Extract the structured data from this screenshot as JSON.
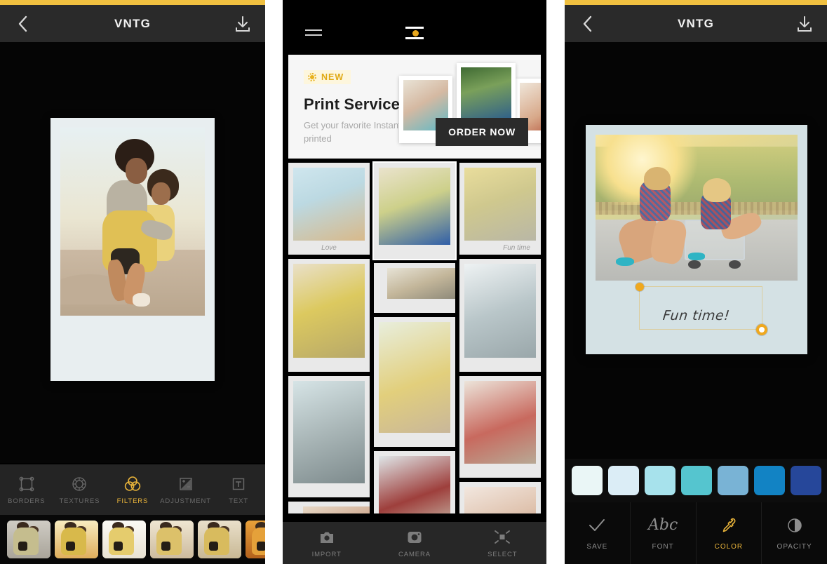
{
  "panel1": {
    "navbar": {
      "back_icon": "chevron-left-icon",
      "title": "VNTG",
      "download_icon": "download-icon"
    },
    "tools": [
      {
        "label": "BORDERS",
        "icon": "borders-icon",
        "active": false
      },
      {
        "label": "TEXTURES",
        "icon": "textures-icon",
        "active": false
      },
      {
        "label": "FILTERS",
        "icon": "filters-icon",
        "active": true
      },
      {
        "label": "ADJUSTMENT",
        "icon": "adjustment-icon",
        "active": false
      },
      {
        "label": "TEXT",
        "icon": "text-icon",
        "active": false
      }
    ],
    "active_tool": "FILTERS",
    "accent_color": "#e8b33a",
    "filter_thumbnails": [
      {
        "name": "filter-thumb-1",
        "tint": "#b9b4ab"
      },
      {
        "name": "filter-thumb-2",
        "tint": "#e8cf8e"
      },
      {
        "name": "filter-thumb-3",
        "tint": "#f3f0e6"
      },
      {
        "name": "filter-thumb-4",
        "tint": "#ddd0b5"
      },
      {
        "name": "filter-thumb-5",
        "tint": "#d6c7a9"
      },
      {
        "name": "filter-thumb-6",
        "tint": "#c98a2e"
      }
    ]
  },
  "panel2": {
    "header": {
      "menu_icon": "hamburger-menu-icon",
      "logo_icon": "app-logo-icon"
    },
    "banner": {
      "badge": "NEW",
      "badge_icon": "sun-icon",
      "title": "Print Service",
      "subtitle": "Get your favorite Instants printed",
      "cta": "ORDER NOW"
    },
    "grid": {
      "columns": [
        {
          "cards": [
            {
              "name": "photo-card-guitar-couple",
              "caption": "Love",
              "h": 122,
              "tint": "linear-gradient(160deg,#cfe6ee 0%,#bcd9e2 40%,#d8b98a 100%)",
              "selected": false
            },
            {
              "name": "photo-card-hat-woman",
              "caption": "",
              "h": 148,
              "tint": "linear-gradient(160deg,#e9e0c9 0%,#dcc95f 45%,#b7a86a 100%)",
              "selected": false
            },
            {
              "name": "photo-card-bw-piggyback",
              "caption": "",
              "h": 160,
              "tint": "linear-gradient(160deg,#d6e4e6 0%,#a9b6b7 50%,#7d8a8c 100%)",
              "selected": false
            },
            {
              "name": "photo-card-three-girls",
              "caption": "",
              "h": 62,
              "tint": "linear-gradient(160deg,#e7d8c6 0%,#cfa98f 60%,#b59577 100%)",
              "selected": false
            }
          ]
        },
        {
          "cards": [
            {
              "name": "photo-card-mother-child",
              "caption": "",
              "h": 128,
              "tint": "linear-gradient(160deg,#eae3cd 0%,#cdd08a 45%,#2f5ea8 100%)",
              "selected": true
            },
            {
              "name": "photo-card-kids-walking",
              "caption": "",
              "h": 58,
              "tint": "linear-gradient(160deg,#e7e3d6 0%,#c3b69a 50%,#8c8878 100%)",
              "selected": false
            },
            {
              "name": "photo-card-beach-piggyback",
              "caption": "",
              "h": 172,
              "tint": "linear-gradient(160deg,#e8eedd 0%,#e2cf7c 55%,#c9b79a 100%)",
              "selected": false
            },
            {
              "name": "photo-card-red-cardigan",
              "caption": "",
              "h": 120,
              "tint": "linear-gradient(160deg,#dfe6e8 0%,#9e3f3c 55%,#c8bfae 100%)",
              "selected": false
            }
          ]
        },
        {
          "cards": [
            {
              "name": "photo-card-skateboard-girls",
              "caption": "Fun time",
              "h": 122,
              "tint": "linear-gradient(160deg,#e9dd9c 0%,#cfc88e 45%,#b9b7a6 100%)",
              "selected": false
            },
            {
              "name": "photo-card-bw-blossom",
              "caption": "",
              "h": 148,
              "tint": "linear-gradient(160deg,#eef2f3 0%,#b9c6c9 50%,#9aa7aa 100%)",
              "selected": false
            },
            {
              "name": "photo-card-guitar-girl",
              "caption": "",
              "h": 132,
              "tint": "linear-gradient(160deg,#ece4da 0%,#c8695e 55%,#b8a995 100%)",
              "selected": false
            },
            {
              "name": "photo-card-child-portrait",
              "caption": "",
              "h": 92,
              "tint": "linear-gradient(160deg,#f2e7df 0%,#e0c4b0 55%,#c79f87 100%)",
              "selected": false
            }
          ]
        }
      ]
    },
    "nav": [
      {
        "label": "IMPORT",
        "icon": "import-photo-icon"
      },
      {
        "label": "CAMERA",
        "icon": "camera-icon"
      },
      {
        "label": "SELECT",
        "icon": "select-icon"
      }
    ]
  },
  "panel3": {
    "navbar": {
      "back_icon": "chevron-left-icon",
      "title": "VNTG",
      "download_icon": "download-icon"
    },
    "caption_text": "Fun time!",
    "frame_color": "#d4e1e4",
    "accent_color": "#efa81e",
    "handles": [
      "text-handle-top-left",
      "text-handle-bottom-right"
    ],
    "swatches": [
      "#eaf6f6",
      "#dbedf6",
      "#a7e2ec",
      "#55c5cf",
      "#79b3d5",
      "#1283c4",
      "#26479a",
      "#1008a8"
    ],
    "tools": [
      {
        "label": "SAVE",
        "icon": "check-icon",
        "active": false
      },
      {
        "label": "FONT",
        "icon": "font-abc-icon",
        "active": false
      },
      {
        "label": "COLOR",
        "icon": "eyedropper-icon",
        "active": true
      },
      {
        "label": "OPACITY",
        "icon": "opacity-half-circle-icon",
        "active": false
      }
    ],
    "active_tool": "COLOR"
  }
}
